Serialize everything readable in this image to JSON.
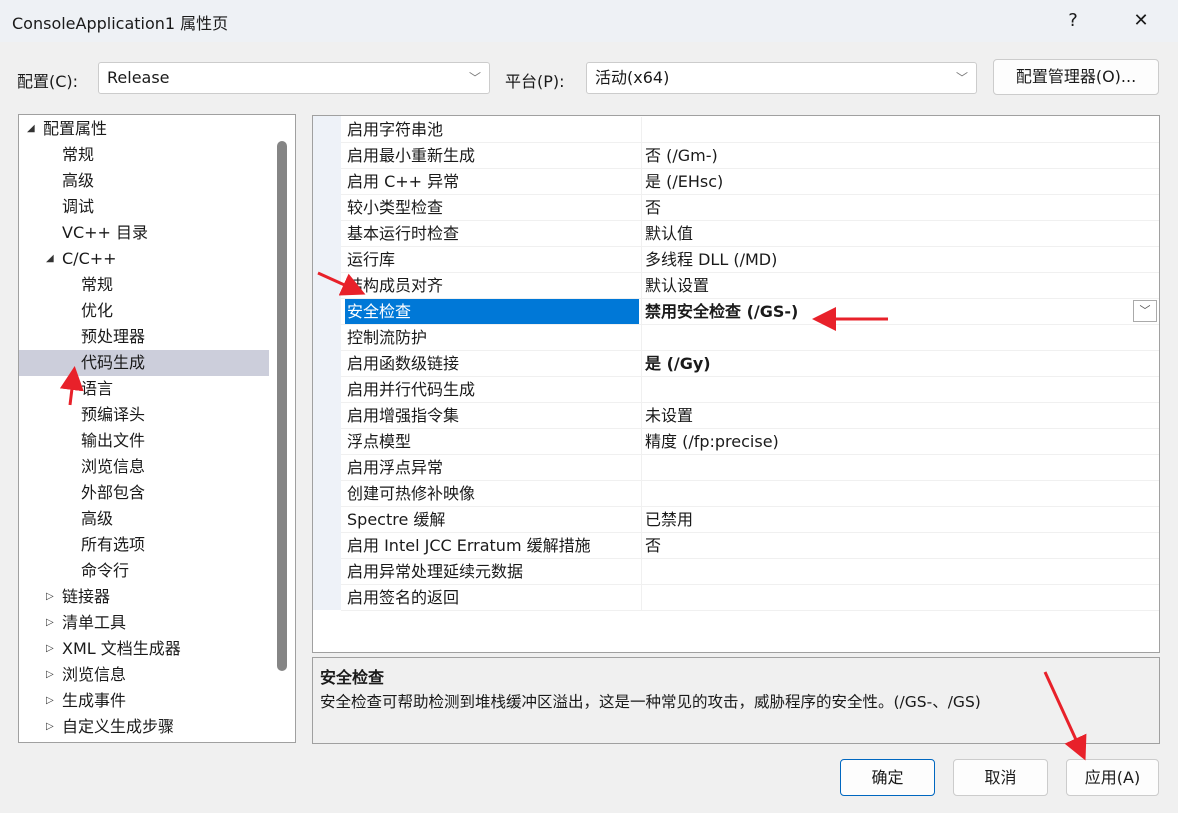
{
  "window": {
    "title": "ConsoleApplication1 属性页",
    "help": "?",
    "close": "✕"
  },
  "config": {
    "label": "配置(C):",
    "value": "Release",
    "platform_label": "平台(P):",
    "platform_value": "活动(x64)",
    "manager_button": "配置管理器(O)..."
  },
  "tree": [
    {
      "label": "配置属性",
      "level": 0,
      "arrow": "◢"
    },
    {
      "label": "常规",
      "level": 1
    },
    {
      "label": "高级",
      "level": 1
    },
    {
      "label": "调试",
      "level": 1
    },
    {
      "label": "VC++ 目录",
      "level": 1
    },
    {
      "label": "C/C++",
      "level": 1,
      "arrow": "◢"
    },
    {
      "label": "常规",
      "level": 2
    },
    {
      "label": "优化",
      "level": 2
    },
    {
      "label": "预处理器",
      "level": 2
    },
    {
      "label": "代码生成",
      "level": 2,
      "selected": true
    },
    {
      "label": "语言",
      "level": 2
    },
    {
      "label": "预编译头",
      "level": 2
    },
    {
      "label": "输出文件",
      "level": 2
    },
    {
      "label": "浏览信息",
      "level": 2
    },
    {
      "label": "外部包含",
      "level": 2
    },
    {
      "label": "高级",
      "level": 2
    },
    {
      "label": "所有选项",
      "level": 2
    },
    {
      "label": "命令行",
      "level": 2
    },
    {
      "label": "链接器",
      "level": 1,
      "arrow": "▷"
    },
    {
      "label": "清单工具",
      "level": 1,
      "arrow": "▷"
    },
    {
      "label": "XML 文档生成器",
      "level": 1,
      "arrow": "▷"
    },
    {
      "label": "浏览信息",
      "level": 1,
      "arrow": "▷"
    },
    {
      "label": "生成事件",
      "level": 1,
      "arrow": "▷"
    },
    {
      "label": "自定义生成步骤",
      "level": 1,
      "arrow": "▷"
    }
  ],
  "properties": [
    {
      "name": "启用字符串池",
      "value": ""
    },
    {
      "name": "启用最小重新生成",
      "value": "否 (/Gm-)"
    },
    {
      "name": "启用 C++ 异常",
      "value": "是 (/EHsc)"
    },
    {
      "name": "较小类型检查",
      "value": "否"
    },
    {
      "name": "基本运行时检查",
      "value": "默认值"
    },
    {
      "name": "运行库",
      "value": "多线程 DLL (/MD)"
    },
    {
      "name": "结构成员对齐",
      "value": "默认设置"
    },
    {
      "name": "安全检查",
      "value": "禁用安全检查 (/GS-)",
      "bold": true,
      "selected": true
    },
    {
      "name": "控制流防护",
      "value": ""
    },
    {
      "name": "启用函数级链接",
      "value": "是 (/Gy)",
      "bold": true
    },
    {
      "name": "启用并行代码生成",
      "value": ""
    },
    {
      "name": "启用增强指令集",
      "value": "未设置"
    },
    {
      "name": "浮点模型",
      "value": "精度 (/fp:precise)"
    },
    {
      "name": "启用浮点异常",
      "value": ""
    },
    {
      "name": "创建可热修补映像",
      "value": ""
    },
    {
      "name": "Spectre 缓解",
      "value": "已禁用"
    },
    {
      "name": "启用 Intel JCC Erratum 缓解措施",
      "value": "否"
    },
    {
      "name": "启用异常处理延续元数据",
      "value": ""
    },
    {
      "name": "启用签名的返回",
      "value": ""
    }
  ],
  "description": {
    "title": "安全检查",
    "text": "安全检查可帮助检测到堆栈缓冲区溢出，这是一种常见的攻击，威胁程序的安全性。(/GS-、/GS)"
  },
  "buttons": {
    "ok": "确定",
    "cancel": "取消",
    "apply": "应用(A)"
  },
  "colors": {
    "selection": "#0078d7",
    "annotation_arrow": "#e8212a"
  }
}
